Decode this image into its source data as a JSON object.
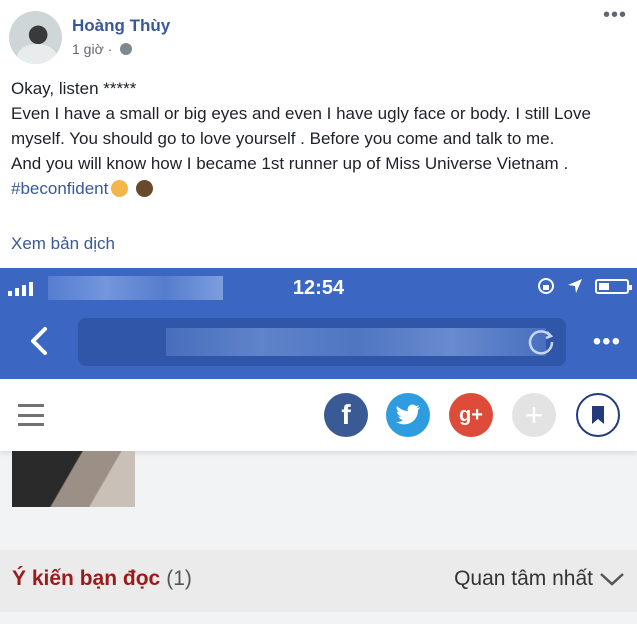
{
  "post": {
    "author": "Hoàng Thùy",
    "time": "1 giờ · ",
    "more_icon": "more-dots-icon",
    "body_lines": [
      "Okay, listen *****",
      "Even I have a small or big eyes and even I have ugly face or body. I still Love myself. You should go to love yourself . Before you come and talk to me.",
      "And you will know how I became 1st runner up of Miss Universe Vietnam ."
    ],
    "hashtag": "#beconfident",
    "see_translation": "Xem bản dịch"
  },
  "screenshot": {
    "status_time": "12:54",
    "share_icons": [
      "facebook-icon",
      "twitter-icon",
      "google-plus-icon",
      "plus-icon",
      "bookmark-icon"
    ],
    "share_glyphs": {
      "facebook": "f",
      "google_plus": "g+",
      "plus": "+"
    },
    "comments_title": "Ý kiến bạn đọc",
    "comments_count": "(1)",
    "sort_label": "Quan tâm nhất"
  },
  "colors": {
    "facebook_blue": "#385898",
    "browser_blue": "#3b67c2",
    "comment_title_red": "#9b1b1b"
  }
}
